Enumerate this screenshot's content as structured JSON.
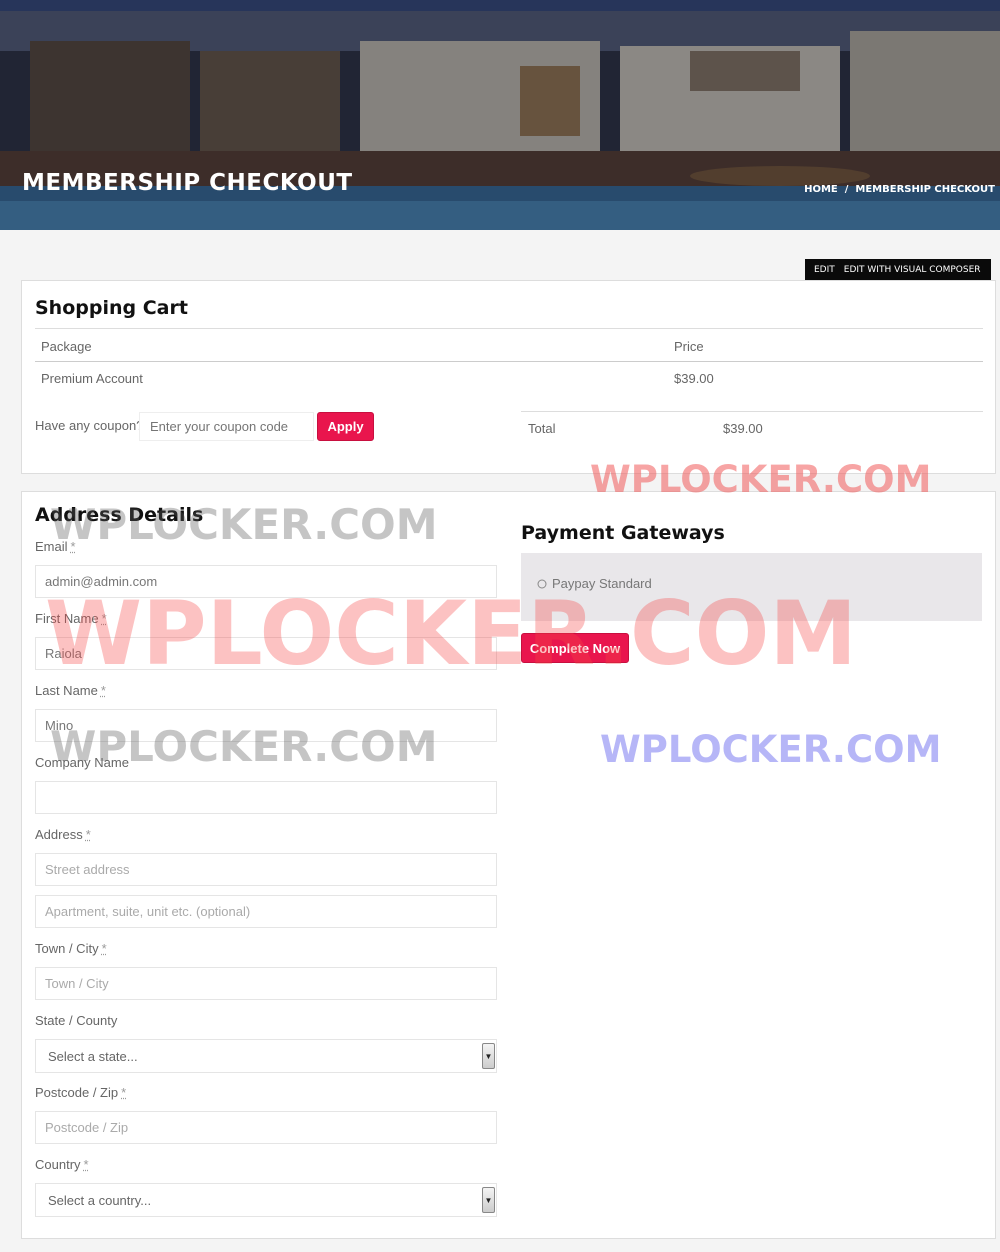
{
  "hero": {
    "title": "MEMBERSHIP CHECKOUT",
    "breadcrumb": {
      "home": "HOME",
      "sep": "/",
      "current": "MEMBERSHIP CHECKOUT"
    }
  },
  "editbar": {
    "edit": "EDIT",
    "edit_vc": "EDIT WITH VISUAL COMPOSER"
  },
  "cart": {
    "title": "Shopping Cart",
    "columns": [
      "Package",
      "Price"
    ],
    "rows": [
      {
        "package": "Premium Account",
        "price": "$39.00"
      }
    ],
    "coupon_label": "Have any coupon?",
    "coupon_placeholder": "Enter your coupon code",
    "apply_label": "Apply",
    "total_label": "Total",
    "total_value": "$39.00"
  },
  "address": {
    "title": "Address Details",
    "required_mark": "*",
    "email_label": "Email",
    "email_value": "admin@admin.com",
    "first_name_label": "First Name",
    "first_name_value": "Raiola",
    "last_name_label": "Last Name",
    "last_name_value": "Mino",
    "company_label": "Company Name",
    "company_value": "",
    "address_label": "Address",
    "street_placeholder": "Street address",
    "apt_placeholder": "Apartment, suite, unit etc. (optional)",
    "city_label": "Town / City",
    "city_placeholder": "Town / City",
    "state_label": "State / County",
    "state_selected": "Select a state...",
    "zip_label": "Postcode / Zip",
    "zip_placeholder": "Postcode / Zip",
    "country_label": "Country",
    "country_selected": "Select a country..."
  },
  "payment": {
    "title": "Payment Gateways",
    "option": "Paypay Standard",
    "complete_label": "Complete Now"
  },
  "watermarks": [
    "WPLOCKER.COM",
    "WPLOCKER.COM",
    "WPLOCKER.COM",
    "WPLOCKER.COM",
    "WPLOCKER.COM"
  ],
  "colors": {
    "accent": "#e9154d",
    "topbar": "#27355a"
  },
  "icons": {
    "radio": "radio-icon",
    "select_arrow": "chevron-down-icon"
  }
}
